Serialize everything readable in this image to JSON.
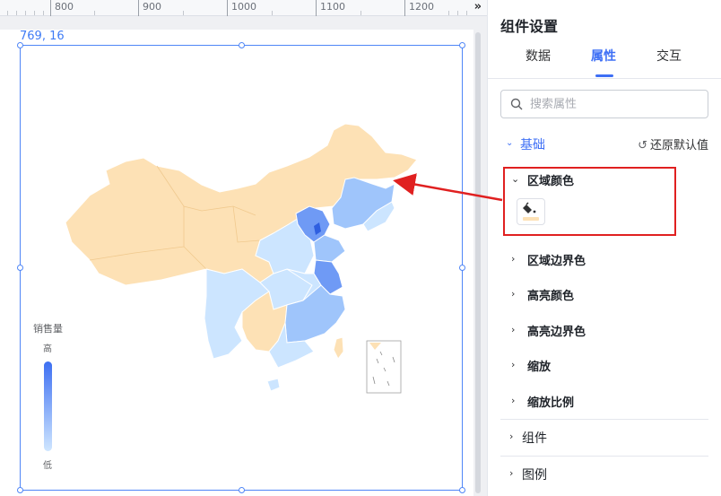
{
  "ruler": {
    "labels": [
      "800",
      "900",
      "1000",
      "1100",
      "1200"
    ]
  },
  "canvas": {
    "coord_readout": "769, 16",
    "collapse_icon": "double-chevron-right-icon"
  },
  "legend": {
    "title": "销售量",
    "high": "高",
    "low": "低",
    "gradient": [
      "#3d6ff2",
      "#cfe6ff"
    ]
  },
  "map_colors": {
    "base": "#fde1b5",
    "light": "#cce5ff",
    "mid": "#9fc5fb",
    "strong": "#6f9af5",
    "darkest": "#2f5fe0"
  },
  "panel": {
    "title": "组件设置",
    "tabs": [
      {
        "label": "数据",
        "active": false
      },
      {
        "label": "属性",
        "active": true
      },
      {
        "label": "交互",
        "active": false
      }
    ],
    "search_placeholder": "搜索属性",
    "section": {
      "label": "基础",
      "reset_label": "还原默认值"
    },
    "properties": [
      {
        "label": "区域颜色",
        "expanded": true
      },
      {
        "label": "区域边界色",
        "expanded": false
      },
      {
        "label": "高亮颜色",
        "expanded": false
      },
      {
        "label": "高亮边界色",
        "expanded": false
      },
      {
        "label": "缩放",
        "expanded": false
      },
      {
        "label": "缩放比例",
        "expanded": false
      }
    ],
    "groups": [
      {
        "label": "组件"
      },
      {
        "label": "图例"
      }
    ],
    "swatch_color": "#fde1b5",
    "accent": "#3e6ff5",
    "annotation_color": "#e02020"
  }
}
